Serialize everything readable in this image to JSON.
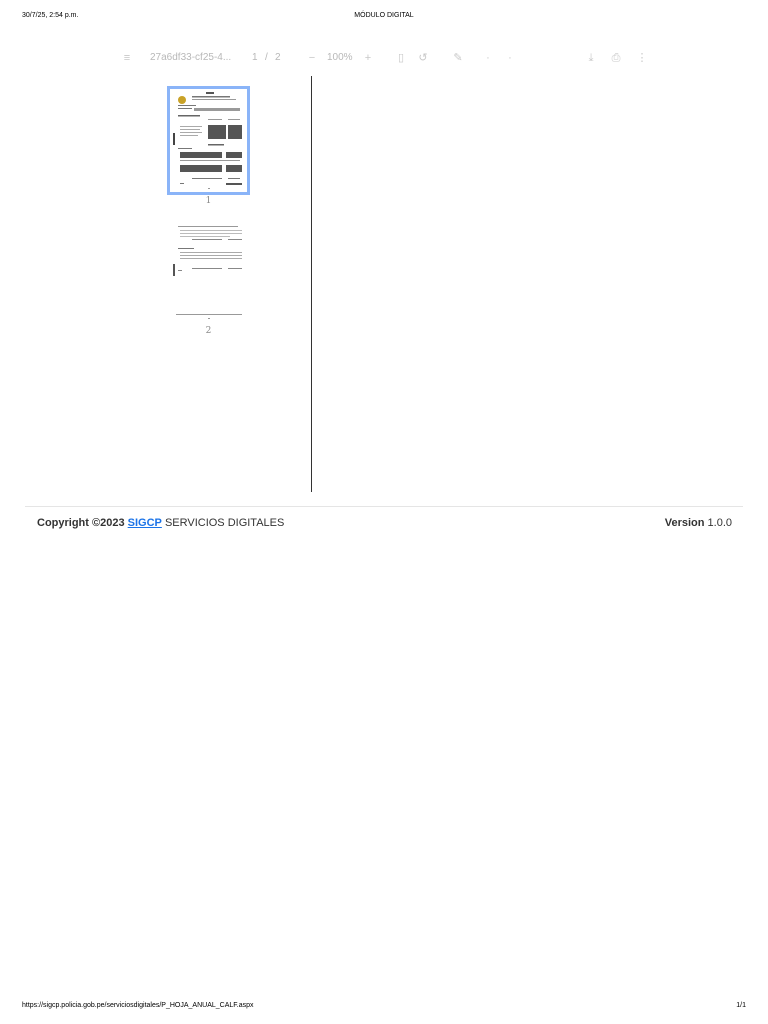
{
  "print_header": {
    "datetime": "30/7/25, 2:54 p.m.",
    "title": "MÓDULO DIGITAL"
  },
  "viewer": {
    "menu_icon": "hamburger-menu-icon",
    "filename": "27a6df33-cf25-4...",
    "page_current": "1",
    "page_separator": "/",
    "page_total": "2",
    "zoom_out_icon": "minus-icon",
    "zoom": "100%",
    "zoom_in_icon": "plus-icon",
    "fit_icon": "fit-page-icon",
    "rotate_icon": "rotate-icon",
    "annotate_icon": "pen-icon",
    "download_icon": "download-icon",
    "print_icon": "print-icon",
    "more_icon": "more-vertical-icon",
    "thumbnails": [
      {
        "label": "1",
        "selected": true
      },
      {
        "label": "2",
        "selected": false
      }
    ]
  },
  "footer": {
    "copyright_prefix": "Copyright ©2023",
    "brand_link": "SIGCP",
    "copyright_suffix": "SERVICIOS DIGITALES",
    "version_label": "Version",
    "version_value": "1.0.0"
  },
  "print_footer": {
    "url": "https://sigcp.policia.gob.pe/serviciosdigitales/P_HOJA_ANUAL_CALF.aspx",
    "pages": "1/1"
  },
  "colors": {
    "selected_outline": "#8ab4f8",
    "link": "#1a73e8"
  }
}
